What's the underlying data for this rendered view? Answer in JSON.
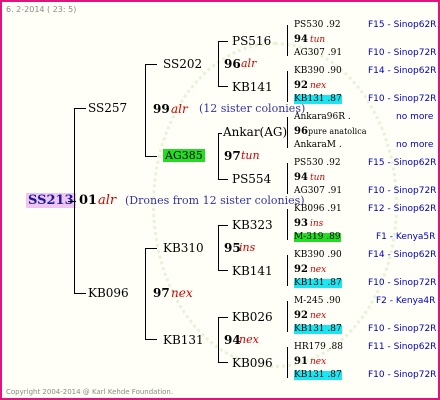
{
  "header": "6. 2-2014 ( 23: 5)",
  "footer": "Copyright 2004-2014 @ Karl Kehde Foundation.",
  "root": {
    "name": "SS213",
    "num": "01",
    "queen": "alr",
    "note": "(Drones from 12 sister colonies)"
  },
  "sire": {
    "name": "SS257",
    "num": "99",
    "queen": "alr",
    "note": "(12 sister colonies)"
  },
  "dam": {
    "name": "KB096",
    "num": "97",
    "queen": "nex"
  },
  "sire_sire": {
    "name": "SS202",
    "num": "96",
    "queen": "alr"
  },
  "sire_dam": {
    "name": "AG385",
    "num": "97",
    "queen": "tun"
  },
  "dam_sire": {
    "name": "KB310",
    "num": "95",
    "queen": "ins"
  },
  "dam_dam": {
    "name": "KB131",
    "num": "94",
    "queen": "nex"
  },
  "gen3": {
    "ss516": "PS516",
    "kb141a": "KB141",
    "ankar_ag": "Ankar(AG)",
    "ps554": "PS554",
    "kb323": "KB323",
    "kb141b": "KB141",
    "kb026": "KB026",
    "kb096": "KB096"
  },
  "leaves": [
    {
      "top": "PS530 .92",
      "mid_num": "94",
      "mid_q": "tun",
      "bot": "AG307 .91",
      "o_top": "F15 - Sinop62R",
      "o_bot": "F10 - Sinop72R"
    },
    {
      "top": "KB390 .90",
      "mid_num": "92",
      "mid_q": "nex",
      "bot": "KB131 .87",
      "o_top": "F14 - Sinop62R",
      "o_bot": "F10 - Sinop72R"
    },
    {
      "top": "Ankara96R .",
      "mid_num": "96",
      "mid_q": "pure anatolica",
      "bot": "AnkaraM .",
      "o_top": "no more",
      "o_bot": "no more"
    },
    {
      "top": "PS530 .92",
      "mid_num": "94",
      "mid_q": "tun",
      "bot": "AG307 .91",
      "o_top": "F15 - Sinop62R",
      "o_bot": "F10 - Sinop72R"
    },
    {
      "top": "KB096 .91",
      "mid_num": "93",
      "mid_q": "ins",
      "bot": "M-319 .89",
      "o_top": "F12 - Sinop62R",
      "o_bot": "F1 - Kenya5R"
    },
    {
      "top": "KB390 .90",
      "mid_num": "92",
      "mid_q": "nex",
      "bot": "KB131 .87",
      "o_top": "F14 - Sinop62R",
      "o_bot": "F10 - Sinop72R"
    },
    {
      "top": "M-245 .90",
      "mid_num": "92",
      "mid_q": "nex",
      "bot": "KB131 .87",
      "o_top": "F2 - Kenya4R",
      "o_bot": "F10 - Sinop72R"
    },
    {
      "top": "HR179 .88",
      "mid_num": "91",
      "mid_q": "nex",
      "bot": "KB131 .87",
      "o_top": "F11 - Sinop62R",
      "o_bot": "F10 - Sinop72R"
    }
  ]
}
